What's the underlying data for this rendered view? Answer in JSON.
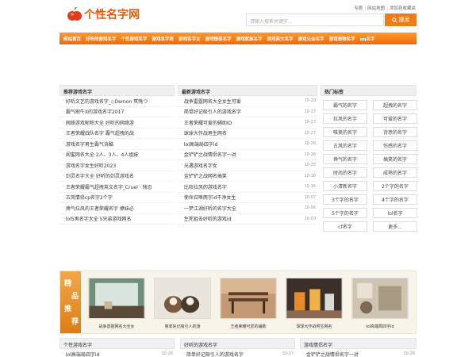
{
  "header": {
    "logo_text": "个性名字网",
    "top_links": [
      "专题",
      "网站地图",
      "添加到收藏夹"
    ],
    "search_placeholder": "请输入搜索关键字...",
    "search_button": "搜索"
  },
  "nav": [
    "网站首页",
    "好听的游戏名字",
    "个性游戏名字",
    "游戏名字男",
    "游戏名字女",
    "游戏情侣名字",
    "游戏家族名字",
    "游戏英文名字",
    "游戏公会名字",
    "游戏宠物名字",
    "qq名字"
  ],
  "left": {
    "title": "推荐游戏名字",
    "items": [
      "好听文艺的游戏名字_◇Demon 冥殇つ",
      "霸气刷牛X的游戏名字2017",
      "网络游戏昵称大全 好听的网络游",
      "王者荣耀战队名字 霸气超拽的战",
      "游戏名字男生霸气诗酷",
      "闺蜜网名大全 2人、3人、4人姐妹",
      "游戏名字女生好听2023",
      "剑灵名字大全 好听的剑灵游戏名",
      "王者荣耀霸气超拽英文名字_Cruel · 残忍",
      "古风情侣cp名字2个字",
      "搀气拉风的王者荣耀名字 撩妹必",
      "lol5男名字大全 5兄弟游戏网名"
    ]
  },
  "middle": {
    "title": "最新游戏名字",
    "items": [
      {
        "text": "战争雷霆网名大全女生可爱",
        "date": "10-29"
      },
      {
        "text": "简单好记吸引人的游戏名字",
        "date": "10-27"
      },
      {
        "text": "王者荣耀可爱的辅助ID",
        "date": "10-27"
      },
      {
        "text": "球球大作战男生网名",
        "date": "10-27"
      },
      {
        "text": "lol高端局四字id",
        "date": "10-26"
      },
      {
        "text": "金铲铲之战情侣名字一对",
        "date": "10-26"
      },
      {
        "text": "光遇游戏名字女",
        "date": "10-25"
      },
      {
        "text": "金铲铲之战网名搞笑",
        "date": "10-18"
      },
      {
        "text": "比较拉风的游戏名字",
        "date": "10-16"
      },
      {
        "text": "使命召唤两字id干净女生",
        "date": "10-07"
      },
      {
        "text": "一梦江湖好听的名字大全",
        "date": "10-06"
      },
      {
        "text": "生死狙击好听的游戏id",
        "date": "10-03"
      }
    ]
  },
  "right": {
    "title": "热门标签",
    "tags": [
      "霸气的名字",
      "超拽的名字",
      "拉风的名字",
      "可爱的名字",
      "唯美的名字",
      "诗意的名字",
      "古风的名字",
      "伤感的名字",
      "搀气的名字",
      "搞笑的名字",
      "时尚的名字",
      "成熟的名字",
      "小清新名字",
      "2个字的名字",
      "3个字的名字",
      "4个字的名字",
      "5个字的名字",
      "lol名字",
      "cf名字",
      "更多..."
    ]
  },
  "featured": {
    "badge": [
      "精",
      "品",
      "推",
      "荐"
    ],
    "items": [
      "战争雷霆网名大全女",
      "简单好记吸引人的游",
      "王者荣耀可爱的辅助",
      "球球大作战男生网名",
      "lol高端局四字id"
    ]
  },
  "bottom": [
    {
      "title": "个性游戏名字",
      "item": "lol高端局四字id",
      "date": "10-26"
    },
    {
      "title": "好听的游戏名字",
      "item": "简单好记吸引人的游戏名字",
      "date": "10-27"
    },
    {
      "title": "游戏情侣名字",
      "item": "金铲铲之战情侣名字一对",
      "date": "10-26"
    }
  ],
  "colors": {
    "accent": "#ee7d18",
    "logo": "#e8590c",
    "badge": "#de7d14"
  }
}
